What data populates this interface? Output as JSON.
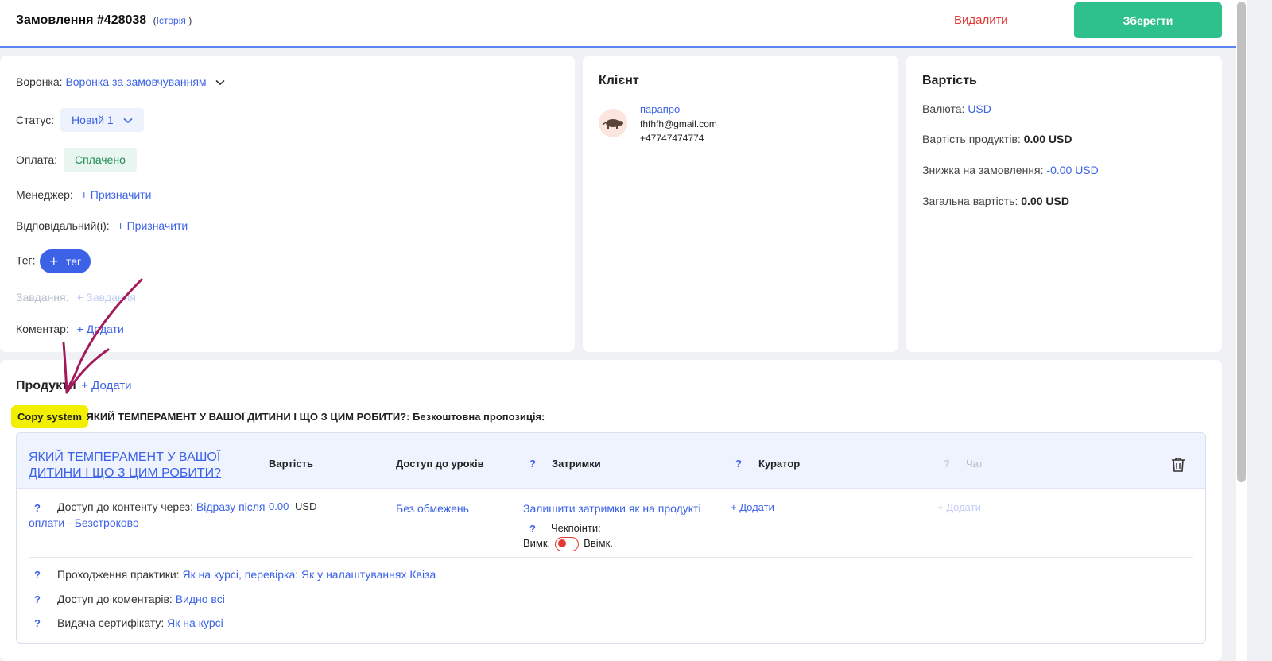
{
  "header": {
    "title": "Замовлення #428038",
    "history_open": "(",
    "history_label": "Історія",
    "history_close": ")",
    "delete_label": "Видалити",
    "save_label": "Зберегти"
  },
  "order": {
    "funnel_label": "Воронка:",
    "funnel_value": "Воронка за замовчуванням",
    "status_label": "Статус:",
    "status_value": "Новий 1",
    "payment_label": "Оплата:",
    "payment_value": "Сплачено",
    "manager_label": "Менеджер:",
    "manager_action": "+ Призначити",
    "responsible_label": "Відповідальний(і):",
    "responsible_action": "+ Призначити",
    "tag_label": "Тег:",
    "tag_button": "тег",
    "tasks_label": "Завдання:",
    "tasks_action": "+ Завдання",
    "comment_label": "Коментар:",
    "comment_action": "+ Додати"
  },
  "client": {
    "section_title": "Клієнт",
    "name": "парапро",
    "email": "fhfhfh@gmail.com",
    "phone": "+47747474774"
  },
  "cost": {
    "section_title": "Вартість",
    "currency_label": "Валюта:",
    "currency_value": "USD",
    "products_label": "Вартість продуктів:",
    "products_value": "0.00 USD",
    "discount_label": "Знижка на замовлення:",
    "discount_value": "-0.00 USD",
    "total_label": "Загальна вартість:",
    "total_value": "0.00 USD"
  },
  "products": {
    "section_title": "Продукти",
    "add_action": "+ Додати",
    "highlight_text": "Copy system",
    "product_line": "ЯКИЙ ТЕМПЕРАМЕНТ У ВАШОЇ ДИТИНИ І ЩО З ЦИМ РОБИТИ?: Безкоштовна пропозиція:",
    "item": {
      "title": "ЯКИЙ ТЕМПЕРАМЕНТ У ВАШОЇ ДИТИНИ І ЩО З ЦИМ РОБИТИ?",
      "col_price": "Вартість",
      "col_access": "Доступ до уроків",
      "col_delays": "Затримки",
      "col_curator": "Куратор",
      "col_chat": "Чат",
      "question": "?",
      "content_access_label": "Доступ до контенту через:",
      "content_access_value": "Відразу після оплати",
      "content_access_sep": "-",
      "content_access_duration": "Безстроково",
      "price_value": "0.00",
      "price_currency": "USD",
      "access_value": "Без обмежень",
      "delays_value": "Залишити затримки як на продукті",
      "checkpoints_label": "Чекпоінти:",
      "toggle_off": "Вимк.",
      "toggle_on": "Ввімк.",
      "curator_action": "+ Додати",
      "chat_action": "+ Додати",
      "practice_label": "Проходження практики:",
      "practice_value": "Як на курсі, перевірка: Як у налаштуваннях Квіза",
      "comments_label": "Доступ до коментарів:",
      "comments_value": "Видно всі",
      "certificate_label": "Видача сертифікату:",
      "certificate_value": "Як на курсі"
    }
  },
  "colors": {
    "accent": "#3c62e8",
    "save": "#2fc18c",
    "danger": "#e53935",
    "annotation": "#a3195b",
    "highlight": "#f2f000"
  }
}
